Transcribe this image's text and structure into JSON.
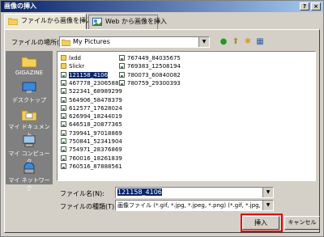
{
  "window": {
    "title": "画像の挿入",
    "help_label": "?",
    "close_label": "×"
  },
  "tabs": [
    {
      "label": "ファイルから画像を挿入"
    },
    {
      "label": "Web から画像を挿入"
    }
  ],
  "location": {
    "label": "ファイルの場所(I):",
    "value": "My Pictures"
  },
  "places": [
    {
      "label": "GIGAZINE"
    },
    {
      "label": "デスクトップ"
    },
    {
      "label": "マイ ドキュメント"
    },
    {
      "label": "マイ コンピュータ"
    },
    {
      "label": "マイ ネットワーク"
    }
  ],
  "files_col1": [
    {
      "name": "lxdd",
      "type": "folder"
    },
    {
      "name": "Slickr",
      "type": "folder"
    },
    {
      "name": "121158_4106",
      "type": "image",
      "selected": true
    },
    {
      "name": "467778_23065882",
      "type": "image"
    },
    {
      "name": "522341_68989299",
      "type": "image"
    },
    {
      "name": "564906_58478379",
      "type": "image"
    },
    {
      "name": "612577_17628024",
      "type": "image"
    },
    {
      "name": "626994_18244019",
      "type": "image"
    },
    {
      "name": "646518_20877365",
      "type": "image"
    },
    {
      "name": "739941_97018869",
      "type": "image"
    },
    {
      "name": "750841_52341904",
      "type": "image"
    },
    {
      "name": "754971_28376869",
      "type": "image"
    },
    {
      "name": "760016_18261839",
      "type": "image"
    },
    {
      "name": "760516_87888561",
      "type": "image"
    }
  ],
  "files_col2": [
    {
      "name": "767449_84035675",
      "type": "image"
    },
    {
      "name": "769383_12508194",
      "type": "image"
    },
    {
      "name": "780073_60840082",
      "type": "image"
    },
    {
      "name": "780759_29300393",
      "type": "image"
    }
  ],
  "filename": {
    "label": "ファイル名(N):",
    "value": "121158_4106"
  },
  "filetype": {
    "label": "ファイルの種類(T):",
    "value": "画像ファイル (*.gif, *.jpg, *.jpeg, *.png) (*.gif, *.jpg, *.jpeg, *.png, *"
  },
  "buttons": {
    "insert": "挿入",
    "cancel": "キャンセル"
  }
}
